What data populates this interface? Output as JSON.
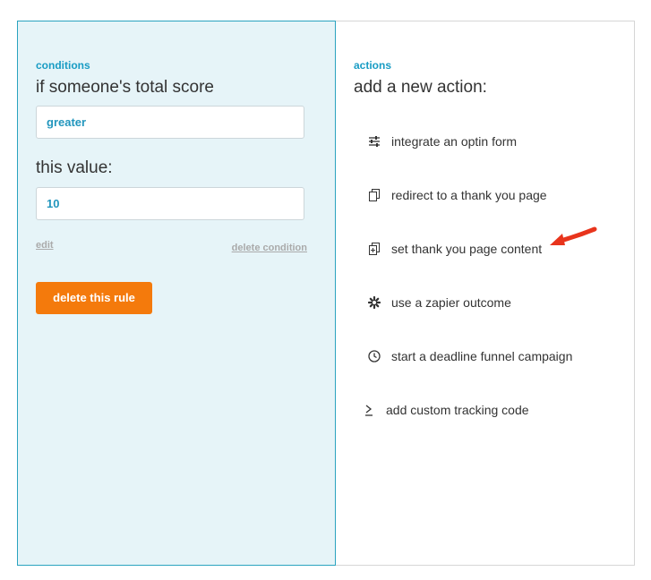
{
  "conditions": {
    "section_label": "conditions",
    "title": "if someone's total score",
    "operator_value": "greater",
    "value_label": "this value:",
    "value": "10",
    "edit_label": "edit",
    "delete_condition_label": "delete condition",
    "delete_rule_label": "delete this rule"
  },
  "actions": {
    "section_label": "actions",
    "title": "add a new action:",
    "items": [
      {
        "label": "integrate an optin form",
        "icon": "sliders-icon"
      },
      {
        "label": "redirect to a thank you page",
        "icon": "copy-page-icon"
      },
      {
        "label": "set thank you page content",
        "icon": "add-page-icon"
      },
      {
        "label": "use a zapier outcome",
        "icon": "zapier-asterisk-icon"
      },
      {
        "label": "start a deadline funnel campaign",
        "icon": "clock-icon"
      },
      {
        "label": "add custom tracking code",
        "icon": "terminal-icon"
      }
    ]
  },
  "colors": {
    "accent": "#199cc4",
    "button": "#f47a0c",
    "arrow": "#e8341c",
    "left_panel_bg": "#e6f4f8"
  }
}
